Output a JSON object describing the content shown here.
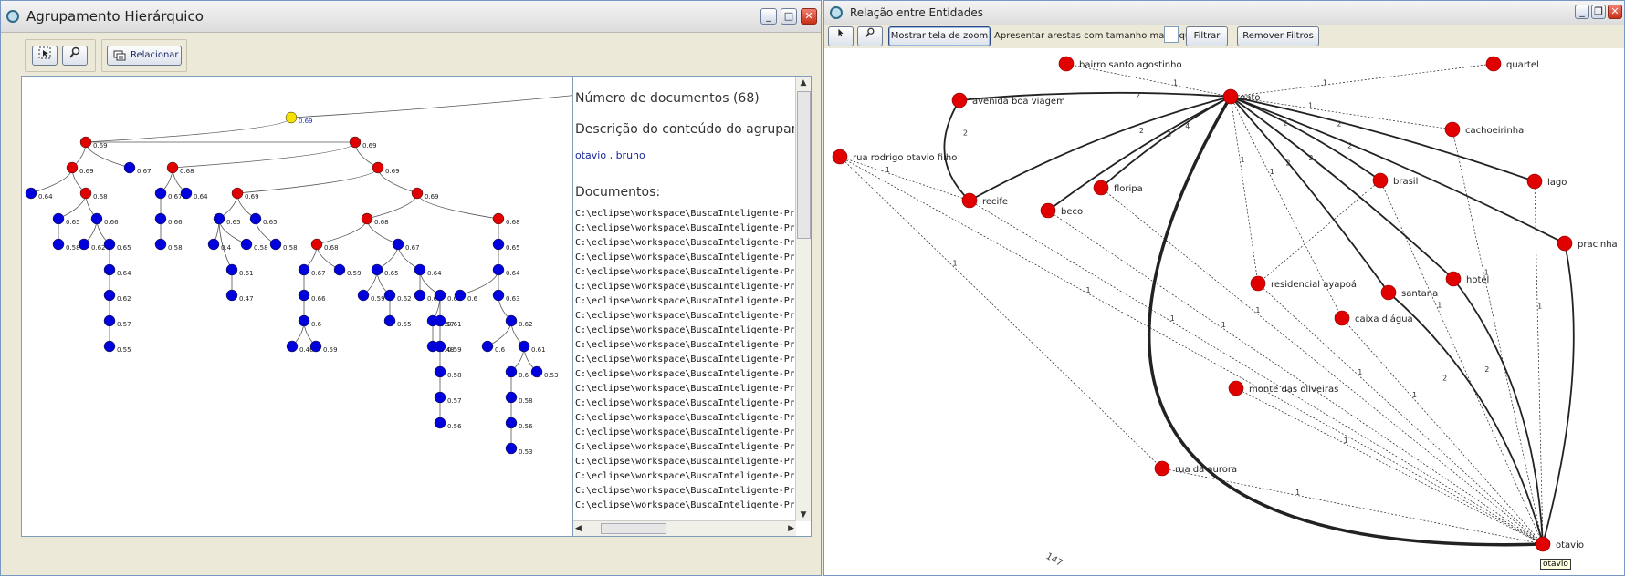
{
  "left_window": {
    "title": "Agrupamento Hierárquico",
    "relate_button": "Relacionar",
    "info": {
      "doc_count": "Número de documentos (68)",
      "desc_heading": "Descrição do conteúdo do agrupan",
      "desc_text": "otavio , bruno",
      "docs_heading": "Documentos:",
      "doc_path": "C:\\eclipse\\workspace\\BuscaInteligente-Principal\\tr"
    },
    "tree": {
      "nodes": [
        {
          "id": "r",
          "l": "0.69",
          "c": "#f5e000"
        },
        {
          "id": "a",
          "l": "0.69",
          "c": "#e00000"
        },
        {
          "id": "b",
          "l": "0.69",
          "c": "#e00000"
        },
        {
          "id": "a1",
          "l": "0.69",
          "c": "#e00000"
        },
        {
          "id": "a2",
          "l": "0.67",
          "c": "#0000dd"
        },
        {
          "id": "a1a",
          "l": "0.64",
          "c": "#0000dd"
        },
        {
          "id": "a1b",
          "l": "0.68",
          "c": "#e00000"
        },
        {
          "id": "a1b1",
          "l": "0.65",
          "c": "#0000dd"
        },
        {
          "id": "a1b2",
          "l": "0.66",
          "c": "#0000dd"
        },
        {
          "id": "a1b1a",
          "l": "0.58",
          "c": "#0000dd"
        },
        {
          "id": "a1b2a",
          "l": "0.62",
          "c": "#0000dd"
        },
        {
          "id": "a1b2b",
          "l": "0.65",
          "c": "#0000dd"
        },
        {
          "id": "a1b2c",
          "l": "0.64",
          "c": "#0000dd"
        },
        {
          "id": "a1b2d",
          "l": "0.62",
          "c": "#0000dd"
        },
        {
          "id": "a1b2e",
          "l": "0.57",
          "c": "#0000dd"
        },
        {
          "id": "a1b2f",
          "l": "0.55",
          "c": "#0000dd"
        },
        {
          "id": "b1",
          "l": "0.68",
          "c": "#e00000"
        },
        {
          "id": "b2",
          "l": "0.69",
          "c": "#e00000"
        },
        {
          "id": "b1a",
          "l": "0.67",
          "c": "#0000dd"
        },
        {
          "id": "b1b",
          "l": "0.64",
          "c": "#0000dd"
        },
        {
          "id": "b1a1",
          "l": "0.66",
          "c": "#0000dd"
        },
        {
          "id": "b1a2",
          "l": "0.58",
          "c": "#0000dd"
        },
        {
          "id": "c",
          "l": "0.69",
          "c": "#e00000"
        },
        {
          "id": "d",
          "l": "0.69",
          "c": "#e00000"
        },
        {
          "id": "c1",
          "l": "0.65",
          "c": "#0000dd"
        },
        {
          "id": "c2",
          "l": "0.65",
          "c": "#0000dd"
        },
        {
          "id": "c1a",
          "l": "0.4",
          "c": "#0000dd"
        },
        {
          "id": "c1b",
          "l": "0.61",
          "c": "#0000dd"
        },
        {
          "id": "c1c",
          "l": "0.58",
          "c": "#0000dd"
        },
        {
          "id": "c2a",
          "l": "0.58",
          "c": "#0000dd"
        },
        {
          "id": "c1b1",
          "l": "0.47",
          "c": "#0000dd"
        },
        {
          "id": "e",
          "l": "0.68",
          "c": "#e00000"
        },
        {
          "id": "f",
          "l": "0.68",
          "c": "#e00000"
        },
        {
          "id": "e1",
          "l": "0.68",
          "c": "#e00000"
        },
        {
          "id": "e2",
          "l": "0.67",
          "c": "#0000dd"
        },
        {
          "id": "e1a",
          "l": "0.67",
          "c": "#0000dd"
        },
        {
          "id": "e1b",
          "l": "0.59",
          "c": "#0000dd"
        },
        {
          "id": "e1a1",
          "l": "0.66",
          "c": "#0000dd"
        },
        {
          "id": "e1a2",
          "l": "0.6",
          "c": "#0000dd"
        },
        {
          "id": "e1a3",
          "l": "0.46",
          "c": "#0000dd"
        },
        {
          "id": "e1a4",
          "l": "0.59",
          "c": "#0000dd"
        },
        {
          "id": "e2a",
          "l": "0.65",
          "c": "#0000dd"
        },
        {
          "id": "e2b",
          "l": "0.64",
          "c": "#0000dd"
        },
        {
          "id": "e2a1",
          "l": "0.59",
          "c": "#0000dd"
        },
        {
          "id": "e2a2",
          "l": "0.62",
          "c": "#0000dd"
        },
        {
          "id": "e2a3",
          "l": "0.55",
          "c": "#0000dd"
        },
        {
          "id": "e2b1",
          "l": "0.62",
          "c": "#0000dd"
        },
        {
          "id": "e2b2",
          "l": "0.61",
          "c": "#0000dd"
        },
        {
          "id": "e2b3",
          "l": "0.57",
          "c": "#0000dd"
        },
        {
          "id": "e2b4",
          "l": "0.48",
          "c": "#0000dd"
        },
        {
          "id": "e2b5",
          "l": "0.61",
          "c": "#0000dd"
        },
        {
          "id": "e2b6",
          "l": "0.59",
          "c": "#0000dd"
        },
        {
          "id": "e2b7",
          "l": "0.58",
          "c": "#0000dd"
        },
        {
          "id": "e2b8",
          "l": "0.57",
          "c": "#0000dd"
        },
        {
          "id": "e2b9",
          "l": "0.56",
          "c": "#0000dd"
        },
        {
          "id": "f1",
          "l": "0.65",
          "c": "#0000dd"
        },
        {
          "id": "f2",
          "l": "0.64",
          "c": "#0000dd"
        },
        {
          "id": "f3",
          "l": "0.6",
          "c": "#0000dd"
        },
        {
          "id": "f4",
          "l": "0.63",
          "c": "#0000dd"
        },
        {
          "id": "f5",
          "l": "0.62",
          "c": "#0000dd"
        },
        {
          "id": "f6",
          "l": "0.6",
          "c": "#0000dd"
        },
        {
          "id": "f7",
          "l": "0.61",
          "c": "#0000dd"
        },
        {
          "id": "f8",
          "l": "0.6",
          "c": "#0000dd"
        },
        {
          "id": "f9",
          "l": "0.53",
          "c": "#0000dd"
        },
        {
          "id": "f10",
          "l": "0.58",
          "c": "#0000dd"
        },
        {
          "id": "f11",
          "l": "0.56",
          "c": "#0000dd"
        },
        {
          "id": "f12",
          "l": "0.53",
          "c": "#0000dd"
        }
      ],
      "edges": [
        [
          "r",
          "a"
        ],
        [
          "a",
          "b"
        ],
        [
          "a",
          "a1"
        ],
        [
          "a",
          "a2"
        ],
        [
          "a1",
          "a1a"
        ],
        [
          "a1",
          "a1b"
        ],
        [
          "a1b",
          "a1b1"
        ],
        [
          "a1b",
          "a1b2"
        ],
        [
          "a1b1",
          "a1b1a"
        ],
        [
          "a1b2",
          "a1b2a"
        ],
        [
          "a1b2",
          "a1b2b"
        ],
        [
          "a1b2b",
          "a1b2c"
        ],
        [
          "a1b2c",
          "a1b2d"
        ],
        [
          "a1b2d",
          "a1b2e"
        ],
        [
          "a1b2e",
          "a1b2f"
        ],
        [
          "b",
          "b1"
        ],
        [
          "b",
          "b2"
        ],
        [
          "b1",
          "b1a"
        ],
        [
          "b1",
          "b1b"
        ],
        [
          "b1a",
          "b1a1"
        ],
        [
          "b1a1",
          "b1a2"
        ],
        [
          "b2",
          "c"
        ],
        [
          "b2",
          "d"
        ],
        [
          "c",
          "c1"
        ],
        [
          "c",
          "c2"
        ],
        [
          "c1",
          "c1a"
        ],
        [
          "c1",
          "c1b"
        ],
        [
          "c1",
          "c1c"
        ],
        [
          "c2",
          "c2a"
        ],
        [
          "c1b",
          "c1b1"
        ],
        [
          "d",
          "e"
        ],
        [
          "d",
          "f"
        ],
        [
          "e",
          "e1"
        ],
        [
          "e",
          "e2"
        ],
        [
          "e1",
          "e1a"
        ],
        [
          "e1",
          "e1b"
        ],
        [
          "e1a",
          "e1a1"
        ],
        [
          "e1a1",
          "e1a2"
        ],
        [
          "e1a2",
          "e1a3"
        ],
        [
          "e1a2",
          "e1a4"
        ],
        [
          "e2",
          "e2a"
        ],
        [
          "e2",
          "e2b"
        ],
        [
          "e2a",
          "e2a1"
        ],
        [
          "e2a",
          "e2a2"
        ],
        [
          "e2a2",
          "e2a3"
        ],
        [
          "e2b",
          "e2b1"
        ],
        [
          "e2b",
          "e2b2"
        ],
        [
          "e2b2",
          "e2b3"
        ],
        [
          "e2b3",
          "e2b4"
        ],
        [
          "e2b2",
          "e2b5"
        ],
        [
          "e2b5",
          "e2b6"
        ],
        [
          "e2b6",
          "e2b7"
        ],
        [
          "e2b7",
          "e2b8"
        ],
        [
          "e2b8",
          "e2b9"
        ],
        [
          "f",
          "f1"
        ],
        [
          "f1",
          "f2"
        ],
        [
          "f2",
          "f3"
        ],
        [
          "f2",
          "f4"
        ],
        [
          "f4",
          "f5"
        ],
        [
          "f5",
          "f6"
        ],
        [
          "f5",
          "f7"
        ],
        [
          "f7",
          "f8"
        ],
        [
          "f7",
          "f9"
        ],
        [
          "f8",
          "f10"
        ],
        [
          "f10",
          "f11"
        ],
        [
          "f11",
          "f12"
        ]
      ]
    }
  },
  "right_window": {
    "title": "Relação entre Entidades",
    "zoom_button": "Mostrar tela de zoom",
    "edge_label": "Apresentar arestas com tamanho maior que",
    "edge_input_value": "",
    "filter_button": "Filtrar",
    "remove_filters_button": "Remover Filtros",
    "tooltip": "otavio",
    "footer_number": "147",
    "graph": {
      "nodes": [
        {
          "id": "gato",
          "l": "gato"
        },
        {
          "id": "otavio",
          "l": "otavio"
        },
        {
          "id": "bairro",
          "l": "bairro santo agostinho"
        },
        {
          "id": "quartel",
          "l": "quartel"
        },
        {
          "id": "avenida",
          "l": "avenida boa viagem"
        },
        {
          "id": "cach",
          "l": "cachoeirinha"
        },
        {
          "id": "rua_rod",
          "l": "rua rodrigo otavio filho"
        },
        {
          "id": "lago",
          "l": "lago"
        },
        {
          "id": "recife",
          "l": "recife"
        },
        {
          "id": "floripa",
          "l": "floripa"
        },
        {
          "id": "beco",
          "l": "beco"
        },
        {
          "id": "brasil",
          "l": "brasil"
        },
        {
          "id": "pracinha",
          "l": "pracinha"
        },
        {
          "id": "resid",
          "l": "residencial ayapoá"
        },
        {
          "id": "santana",
          "l": "santana"
        },
        {
          "id": "hotel",
          "l": "hotel"
        },
        {
          "id": "caixa",
          "l": "caixa d'água"
        },
        {
          "id": "monte",
          "l": "monte das oliveiras"
        },
        {
          "id": "rua_aur",
          "l": "rua da aurora"
        }
      ],
      "edges": [
        {
          "s": "gato",
          "t": "bairro",
          "w": 1,
          "d": true,
          "lab": "1"
        },
        {
          "s": "gato",
          "t": "quartel",
          "w": 1,
          "d": true,
          "lab": "1"
        },
        {
          "s": "gato",
          "t": "avenida",
          "w": 2,
          "d": false,
          "lab": "2"
        },
        {
          "s": "gato",
          "t": "recife",
          "w": 2,
          "d": false,
          "lab": "2"
        },
        {
          "s": "gato",
          "t": "beco",
          "w": 2,
          "d": false,
          "lab": "3"
        },
        {
          "s": "gato",
          "t": "floripa",
          "w": 2,
          "d": false,
          "lab": "4"
        },
        {
          "s": "gato",
          "t": "cach",
          "w": 1,
          "d": true,
          "lab": "1"
        },
        {
          "s": "gato",
          "t": "lago",
          "w": 2,
          "d": false,
          "lab": "2"
        },
        {
          "s": "gato",
          "t": "pracinha",
          "w": 2,
          "d": false,
          "lab": "2"
        },
        {
          "s": "gato",
          "t": "brasil",
          "w": 2,
          "d": false,
          "lab": "2"
        },
        {
          "s": "gato",
          "t": "santana",
          "w": 2,
          "d": false,
          "lab": "2"
        },
        {
          "s": "gato",
          "t": "hotel",
          "w": 2,
          "d": false,
          "lab": "2"
        },
        {
          "s": "gato",
          "t": "resid",
          "w": 1,
          "d": true,
          "lab": "1"
        },
        {
          "s": "gato",
          "t": "caixa",
          "w": 1,
          "d": true,
          "lab": "1"
        },
        {
          "s": "gato",
          "t": "otavio",
          "w": 4,
          "d": false,
          "lab": ""
        },
        {
          "s": "avenida",
          "t": "recife",
          "w": 2,
          "d": false,
          "lab": "2"
        },
        {
          "s": "rua_rod",
          "t": "recife",
          "w": 1,
          "d": true,
          "lab": "1"
        },
        {
          "s": "rua_rod",
          "t": "rua_aur",
          "w": 1,
          "d": true,
          "lab": "1"
        },
        {
          "s": "rua_rod",
          "t": "otavio",
          "w": 1,
          "d": true,
          "lab": "1"
        },
        {
          "s": "recife",
          "t": "otavio",
          "w": 1,
          "d": true,
          "lab": "1"
        },
        {
          "s": "beco",
          "t": "otavio",
          "w": 1,
          "d": true,
          "lab": "1"
        },
        {
          "s": "floripa",
          "t": "otavio",
          "w": 1,
          "d": true,
          "lab": "1"
        },
        {
          "s": "brasil",
          "t": "resid",
          "w": 1,
          "d": true,
          "lab": ""
        },
        {
          "s": "brasil",
          "t": "otavio",
          "w": 1,
          "d": true,
          "lab": "1"
        },
        {
          "s": "cach",
          "t": "otavio",
          "w": 1,
          "d": true,
          "lab": "1"
        },
        {
          "s": "lago",
          "t": "otavio",
          "w": 1,
          "d": true,
          "lab": "1"
        },
        {
          "s": "pracinha",
          "t": "otavio",
          "w": 2,
          "d": false,
          "lab": ""
        },
        {
          "s": "santana",
          "t": "otavio",
          "w": 2,
          "d": false,
          "lab": "2"
        },
        {
          "s": "hotel",
          "t": "otavio",
          "w": 2,
          "d": false,
          "lab": "2"
        },
        {
          "s": "caixa",
          "t": "otavio",
          "w": 1,
          "d": true,
          "lab": "1"
        },
        {
          "s": "monte",
          "t": "otavio",
          "w": 1,
          "d": true,
          "lab": "1"
        },
        {
          "s": "rua_aur",
          "t": "otavio",
          "w": 1,
          "d": true,
          "lab": "1"
        },
        {
          "s": "resid",
          "t": "otavio",
          "w": 1,
          "d": true,
          "lab": "1"
        }
      ]
    }
  },
  "colors": {
    "red_node": "#e00000",
    "blue_node": "#0000dd",
    "root_node": "#f5e000"
  }
}
